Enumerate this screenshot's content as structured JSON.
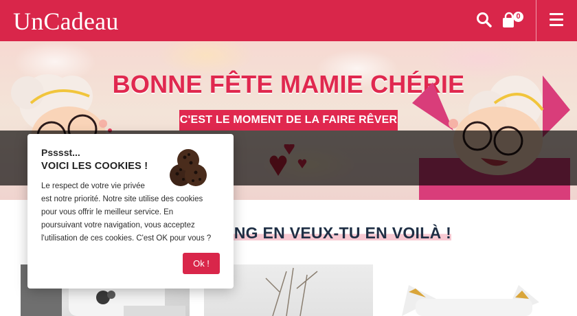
{
  "header": {
    "logo": "UnCadeau",
    "cart_count": "0",
    "background": "#d9264a"
  },
  "hero": {
    "title": "BONNE FÊTE MAMIE CHÉRIE",
    "subtitle": "C'EST LE MOMENT DE LA FAIRE RÊVER"
  },
  "section": {
    "title": "ING EN VEUX-TU EN VOILÀ !"
  },
  "cookie": {
    "pre_title": "Psssst...",
    "title": "VOICI LES COOKIES !",
    "body_lines": [
      "Le respect de votre vie privée",
      "est notre priorité. Notre site utilise des cookies",
      "pour vous offrir le meilleur service. En",
      "poursuivant votre navigation, vous acceptez",
      "l'utilisation de ces cookies. C'est OK pour vous ?"
    ],
    "ok_label": "Ok !"
  },
  "icons": {
    "search": "search-icon",
    "cart": "shopping-bag-icon",
    "menu": "hamburger-menu-icon",
    "cookie": "cookie-icon"
  },
  "colors": {
    "accent": "#d9264a",
    "heading": "#1f2f45"
  }
}
